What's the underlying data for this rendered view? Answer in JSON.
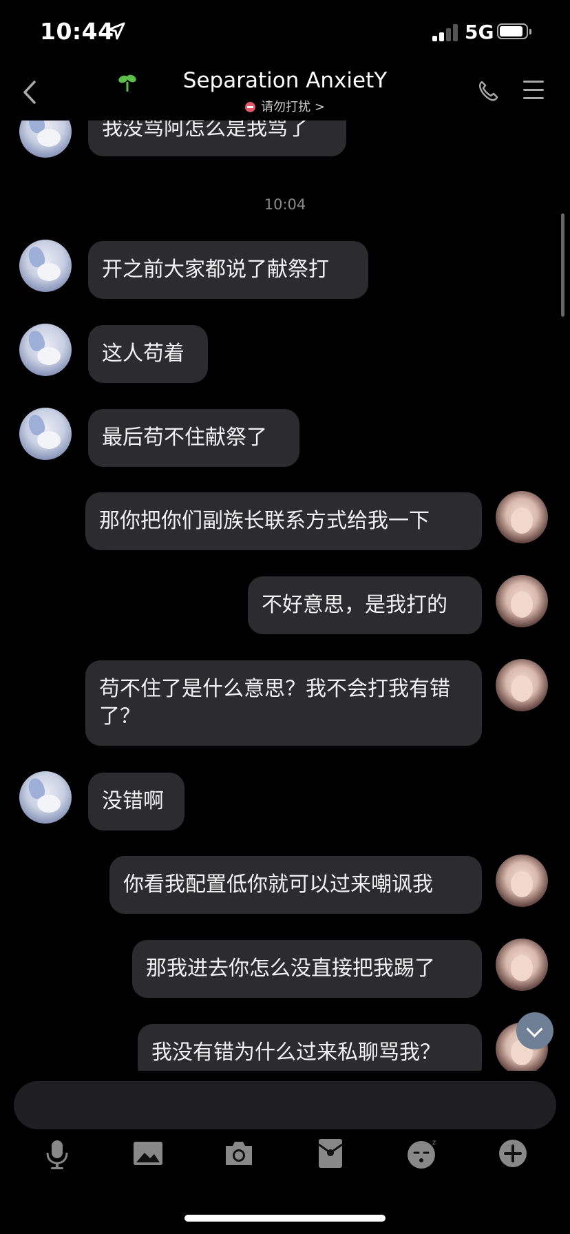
{
  "status_bar": {
    "time": "10:44",
    "network": "5G"
  },
  "header": {
    "title": "Separation AnxietY",
    "subtitle": "请勿打扰 >"
  },
  "messages": [
    {
      "side": "left",
      "text": "我没骂阿怎么是我骂了"
    },
    {
      "timestamp": "10:04"
    },
    {
      "side": "left",
      "text": "开之前大家都说了献祭打"
    },
    {
      "side": "left",
      "text": "这人苟着"
    },
    {
      "side": "left",
      "text": "最后苟不住献祭了"
    },
    {
      "side": "right",
      "text": "那你把你们副族长联系方式给我一下"
    },
    {
      "side": "right",
      "text": "不好意思，是我打的"
    },
    {
      "side": "right",
      "text": "苟不住了是什么意思？我不会打我有错了？"
    },
    {
      "side": "left",
      "text": "没错啊"
    },
    {
      "side": "right",
      "text": "你看我配置低你就可以过来嘲讽我"
    },
    {
      "side": "right",
      "text": "那我进去你怎么没直接把我踢了"
    },
    {
      "side": "right",
      "text": "我没有错为什么过来私聊骂我？"
    }
  ],
  "toolbar": {
    "icons": [
      "microphone-icon",
      "image-icon",
      "camera-icon",
      "red-packet-icon",
      "emoji-icon",
      "plus-icon"
    ]
  }
}
